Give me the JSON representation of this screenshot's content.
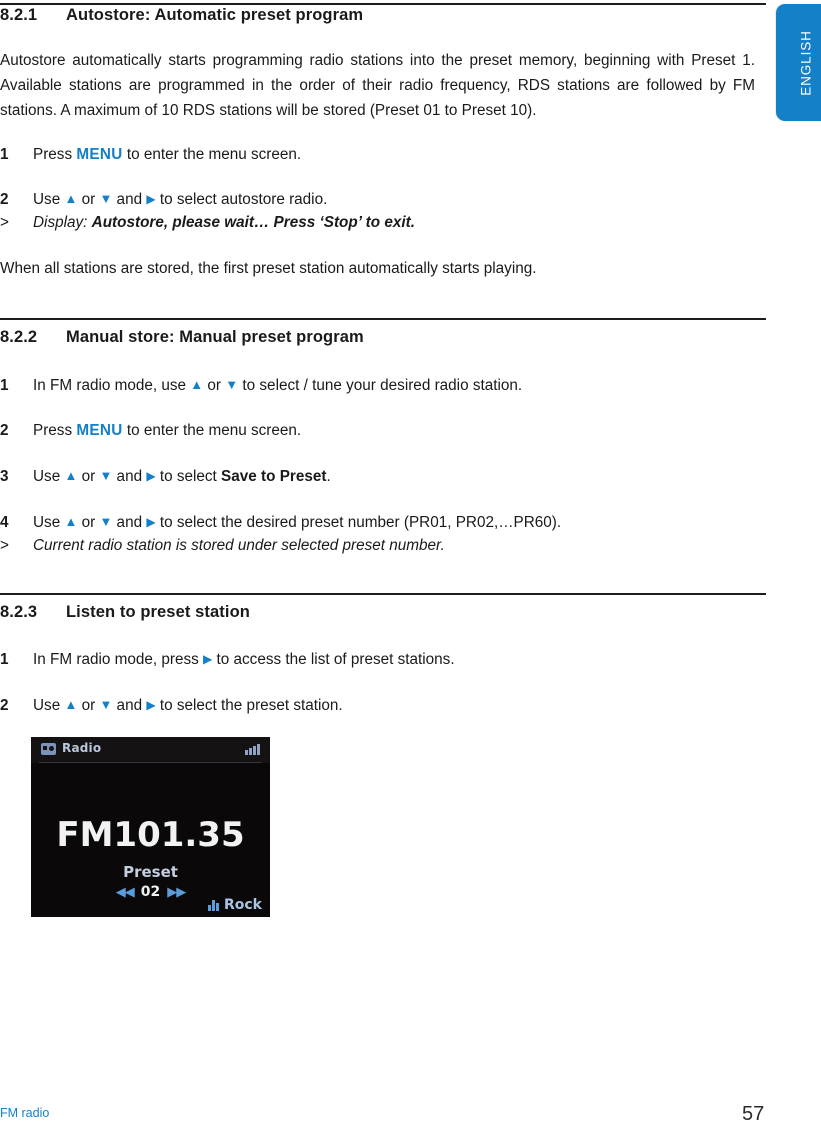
{
  "language_tab": {
    "label": "ENGLISH"
  },
  "sections": [
    {
      "number": "8.2.1",
      "title": "Autostore: Automatic preset program",
      "intro": "Autostore automatically starts programming radio stations into the preset memory, beginning with Preset 1. Available stations are programmed in the order of their radio frequency, RDS stations are followed by FM stations. A maximum of 10 RDS stations will be stored (Preset 01 to Preset 10).",
      "steps": [
        {
          "marker": "1",
          "pre": "Press ",
          "keyword": "MENU",
          "post": " to enter the menu screen."
        },
        {
          "marker": "2",
          "pre": "Use ",
          "mid": " or ",
          "mid2": " and ",
          "post": " to select autostore radio."
        },
        {
          "marker": ">",
          "note_lead": "Display: ",
          "note_bold": "Autostore, please wait… Press ‘Stop’ to exit."
        }
      ],
      "outro": "When all stations are stored, the first preset station automatically starts playing."
    },
    {
      "number": "8.2.2",
      "title": "Manual store: Manual preset program",
      "steps": [
        {
          "marker": "1",
          "pre": "In FM radio mode, use ",
          "mid": " or ",
          "post": " to select / tune your desired radio station."
        },
        {
          "marker": "2",
          "pre": "Press ",
          "keyword": "MENU",
          "post": " to enter the menu screen."
        },
        {
          "marker": "3",
          "pre": "Use ",
          "mid": " or ",
          "mid2": " and ",
          "post": " to select ",
          "bold": "Save to Preset",
          "tail": "."
        },
        {
          "marker": "4",
          "pre": "Use ",
          "mid": " or ",
          "mid2": " and ",
          "post": " to select the desired preset number (PR01, PR02,…PR60)."
        },
        {
          "marker": ">",
          "note": "Current radio station is stored under selected preset number."
        }
      ]
    },
    {
      "number": "8.2.3",
      "title": "Listen to preset station",
      "steps": [
        {
          "marker": "1",
          "pre": "In FM radio mode, press ",
          "post": " to access the list of preset stations."
        },
        {
          "marker": "2",
          "pre": "Use ",
          "mid": " or ",
          "mid2": " and ",
          "post": " to select the preset station."
        }
      ]
    }
  ],
  "device_screen": {
    "title": "Radio",
    "frequency": "FM101.35",
    "preset_label": "Preset",
    "preset_number": "02",
    "skip_prev": "◀◀",
    "skip_next": "▶▶",
    "equalizer": "Rock"
  },
  "footer": {
    "left": "FM radio",
    "page_number": "57"
  },
  "colors": {
    "accent_blue": "#1380c8",
    "text": "#1a1a1a"
  }
}
